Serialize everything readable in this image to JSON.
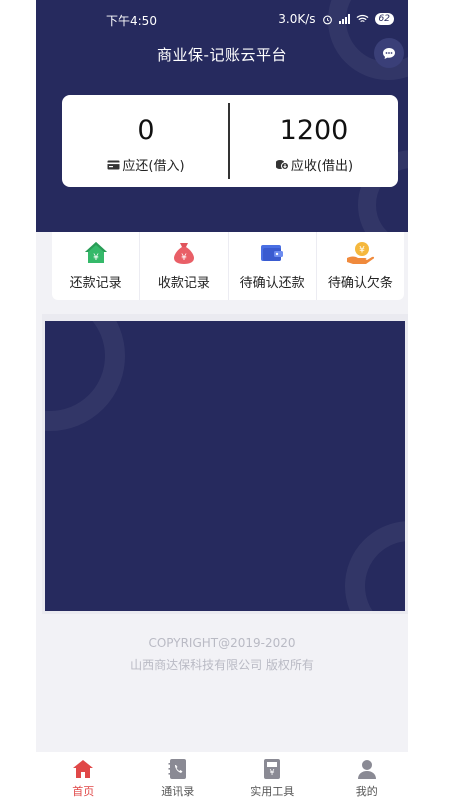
{
  "status_bar": {
    "time": "下午4:50",
    "net_speed": "3.0K/s",
    "battery": "62"
  },
  "header": {
    "title": "商业保-记账云平台"
  },
  "summary": {
    "repay_amount": "0",
    "repay_label": "应还(借入)",
    "receive_amount": "1200",
    "receive_label": "应收(借出)"
  },
  "menu": {
    "items": [
      {
        "label": "还款记录",
        "icon": "green-house-yuan-icon"
      },
      {
        "label": "收款记录",
        "icon": "red-money-bag-icon"
      },
      {
        "label": "待确认还款",
        "icon": "blue-wallet-icon"
      },
      {
        "label": "待确认欠条",
        "icon": "hand-coin-icon"
      }
    ]
  },
  "footer": {
    "copyright": "COPYRIGHT@2019-2020",
    "company": "山西商达保科技有限公司 版权所有"
  },
  "tabbar": {
    "tabs": [
      {
        "label": "首页",
        "icon": "home-icon",
        "active": true
      },
      {
        "label": "通讯录",
        "icon": "contacts-icon",
        "active": false
      },
      {
        "label": "实用工具",
        "icon": "tools-icon",
        "active": false
      },
      {
        "label": "我的",
        "icon": "user-icon",
        "active": false
      }
    ]
  },
  "colors": {
    "brand": "#262a5e",
    "active_tab": "#e04848"
  }
}
